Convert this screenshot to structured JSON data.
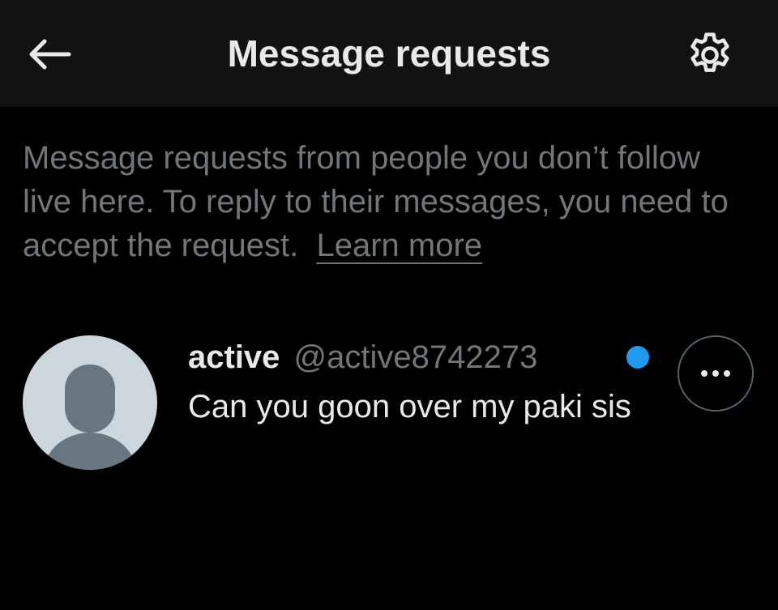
{
  "header": {
    "back_icon": "arrow-left-icon",
    "title": "Message requests",
    "settings_icon": "gear-icon"
  },
  "info": {
    "text": "Message requests from people you don’t follow live here. To reply to their messages, you need to accept the request.",
    "learn_more": "Learn more"
  },
  "requests": [
    {
      "name": "active",
      "handle": "@active8742273",
      "message": "Can you goon over my paki sis",
      "unread": true,
      "more_icon": "more-horizontal-icon"
    }
  ],
  "colors": {
    "background": "#000000",
    "header_background": "#121212",
    "primary_text": "#e7e9ea",
    "secondary_text": "#71767b",
    "accent_blue": "#1d9bf0",
    "avatar_background": "#ccd6dd",
    "avatar_figure": "#687684"
  }
}
